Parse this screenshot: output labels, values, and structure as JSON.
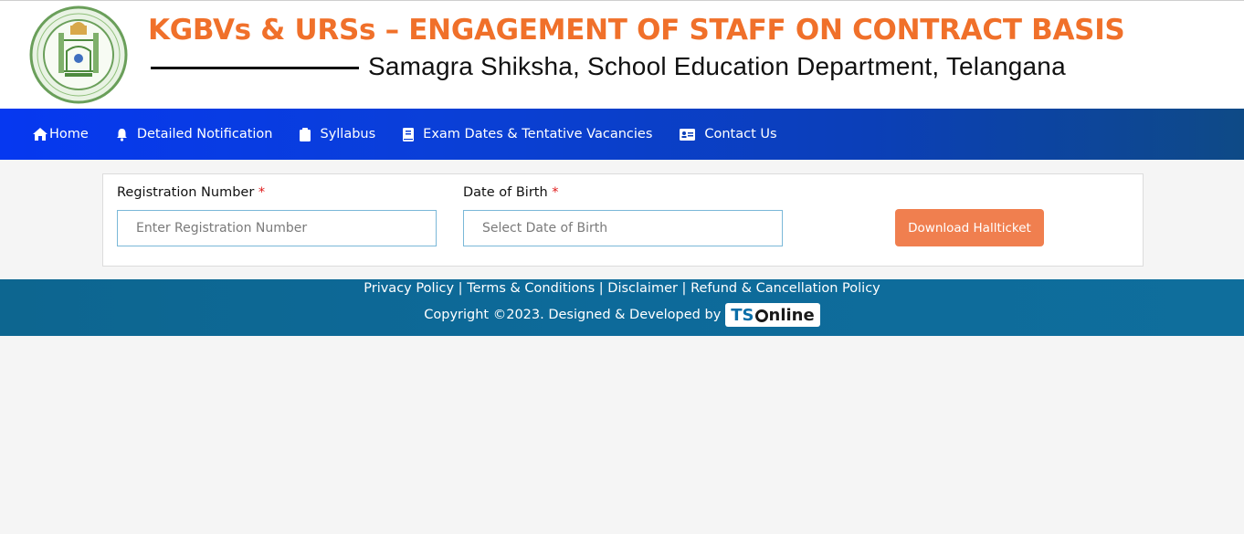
{
  "header": {
    "title": "KGBVs & URSs – ENGAGEMENT OF STAFF ON CONTRACT BASIS",
    "subtitle": "Samagra Shiksha, School Education Department, Telangana",
    "emblem_text": "GOVERNMENT OF TELANGANA"
  },
  "nav": {
    "items": [
      {
        "label": "Home",
        "icon": "home-icon"
      },
      {
        "label": "Detailed Notification",
        "icon": "bell-icon"
      },
      {
        "label": "Syllabus",
        "icon": "clipboard-icon"
      },
      {
        "label": "Exam Dates & Tentative Vacancies",
        "icon": "book-icon"
      },
      {
        "label": "Contact Us",
        "icon": "id-card-icon"
      }
    ]
  },
  "form": {
    "registration_label": "Registration Number",
    "registration_placeholder": "Enter Registration Number",
    "dob_label": "Date of Birth",
    "dob_placeholder": "Select Date of Birth",
    "required_mark": "*",
    "download_button": "Download Hallticket"
  },
  "footer": {
    "links": [
      "Privacy Policy",
      "Terms & Conditions",
      "Disclaimer",
      "Refund & Cancellation Policy"
    ],
    "separator": " | ",
    "copyright": "Copyright ©2023. Designed & Developed by",
    "logo_ts": "TS",
    "logo_online": "nline"
  },
  "colors": {
    "title_orange": "#f0702a",
    "nav_blue": "#0638f0",
    "button_orange": "#f07f4f",
    "footer_teal": "#0d6690",
    "required_red": "#e01b1b"
  }
}
